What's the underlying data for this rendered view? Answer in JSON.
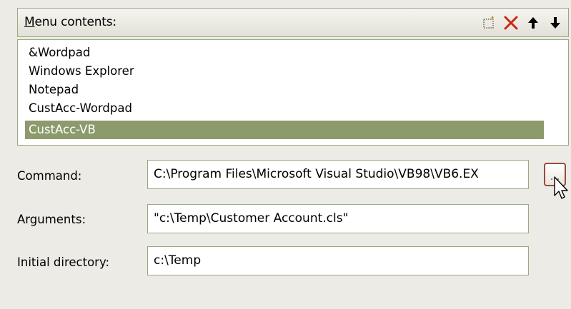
{
  "menu_header": {
    "label_mnemonic": "M",
    "label_rest": "enu contents:",
    "toolbar": [
      {
        "name": "new-item-icon"
      },
      {
        "name": "delete-icon",
        "color": "#c42a14"
      },
      {
        "name": "move-up-icon"
      },
      {
        "name": "move-down-icon"
      }
    ]
  },
  "menu_items": [
    {
      "label": "&Wordpad"
    },
    {
      "label": "Windows Explorer"
    },
    {
      "label": "Notepad"
    },
    {
      "label": "CustAcc-Wordpad"
    },
    {
      "label": "CustAcc-VB",
      "selected": true
    }
  ],
  "fields": {
    "command": {
      "label": "Command:",
      "value": "C:\\Program Files\\Microsoft Visual Studio\\VB98\\VB6.EX"
    },
    "arguments": {
      "label": "Arguments:",
      "value": "\"c:\\Temp\\Customer Account.cls\""
    },
    "initial_directory": {
      "label": "Initial directory:",
      "value": "c:\\Temp"
    }
  },
  "browse_button": {
    "label": "..."
  },
  "colors": {
    "selection": "#8c9a6c",
    "border": "#9aa983",
    "delete_icon": "#c42a14",
    "browse_border": "#9b4b3f"
  }
}
